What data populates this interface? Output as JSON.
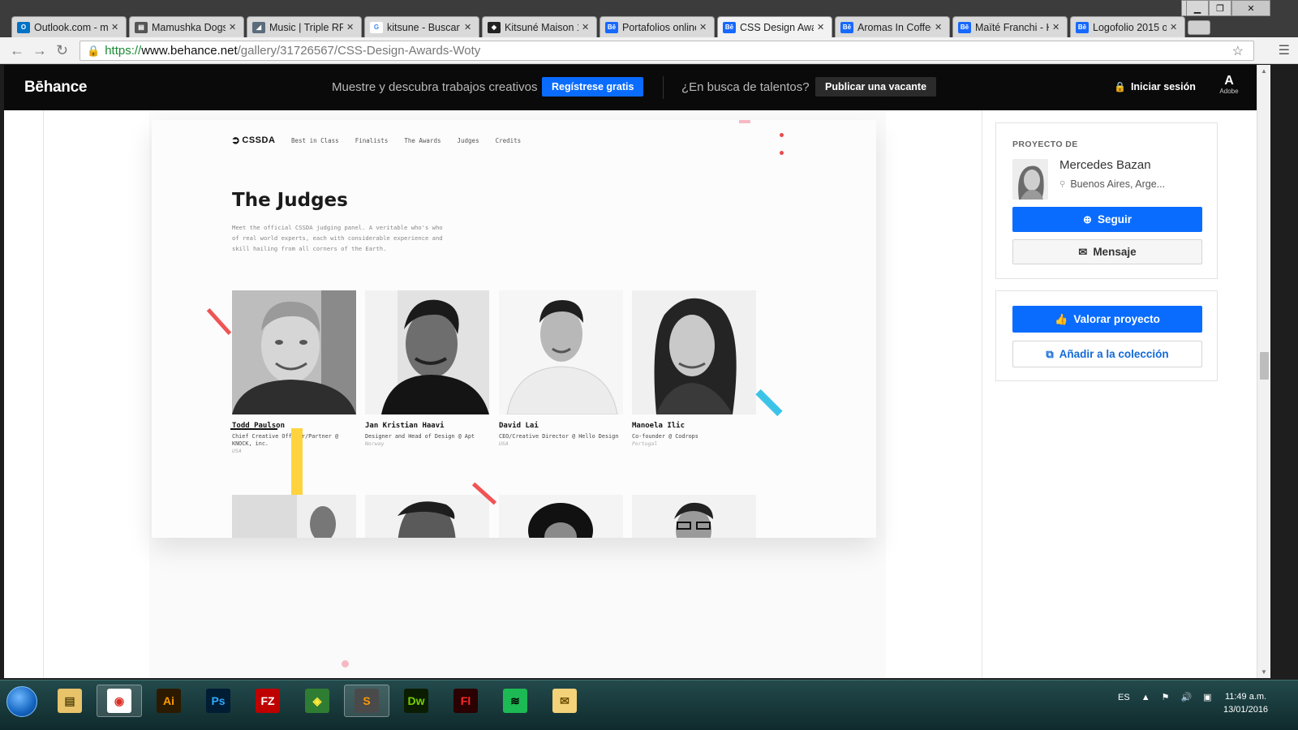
{
  "browser": {
    "tabs": [
      {
        "label": "Outlook.com - m",
        "fav_color": "#0072c6",
        "fav_text": "O"
      },
      {
        "label": "Mamushka Dogs",
        "fav_color": "#555555",
        "fav_text": "▤"
      },
      {
        "label": "Music | Triple RR",
        "fav_color": "#5a6b7c",
        "fav_text": "◢"
      },
      {
        "label": "kitsune - Buscar c",
        "fav_color": "#ffffff",
        "fav_text": "G"
      },
      {
        "label": "Kitsuné Maison 1",
        "fav_color": "#222222",
        "fav_text": "◆"
      },
      {
        "label": "Portafolios online",
        "fav_color": "#1769ff",
        "fav_text": "Bē"
      },
      {
        "label": "CSS Design Awar",
        "fav_color": "#1769ff",
        "fav_text": "Bē",
        "active": true
      },
      {
        "label": "Aromas In Coffee",
        "fav_color": "#1769ff",
        "fav_text": "Bē"
      },
      {
        "label": "Maïté Franchi - H",
        "fav_color": "#1769ff",
        "fav_text": "Bē"
      },
      {
        "label": "Logofolio 2015 o",
        "fav_color": "#1769ff",
        "fav_text": "Bē"
      }
    ],
    "url_scheme": "https://",
    "url_host": "www.behance.net",
    "url_path": "/gallery/31726567/CSS-Design-Awards-Woty"
  },
  "behance": {
    "logo": "Bēhance",
    "tagline": "Muestre y descubra trabajos creativos",
    "register_label": "Regístrese gratis",
    "talent_text": "¿En busca de talentos?",
    "post_job_label": "Publicar una vacante",
    "login_label": "Iniciar sesión",
    "adobe_label": "Adobe"
  },
  "project": {
    "logo": "CSSDA",
    "nav": [
      "Best in Class",
      "Finalists",
      "The Awards",
      "Judges",
      "Credits"
    ],
    "title": "The Judges",
    "intro": "Meet the official CSSDA judging panel. A veritable who's who of real world experts, each with considerable experience and skill hailing from all corners of the Earth.",
    "judges": [
      {
        "name": "Todd Paulson",
        "role": "Chief Creative Officer/Partner @ KNOCK, inc.",
        "country": "USA"
      },
      {
        "name": "Jan Kristian Haavi",
        "role": "Designer and Head of Design @ Apt",
        "country": "Norway"
      },
      {
        "name": "David Lai",
        "role": "CEO/Creative Director @ Hello Design",
        "country": "USA"
      },
      {
        "name": "Manoela Ilic",
        "role": "Co-founder @ Codrops",
        "country": "Portugal"
      }
    ]
  },
  "sidebar": {
    "project_by_label": "PROYECTO DE",
    "owner_name": "Mercedes Bazan",
    "owner_location": "Buenos Aires, Arge...",
    "follow_label": "Seguir",
    "message_label": "Mensaje",
    "appreciate_label": "Valorar proyecto",
    "collection_label": "Añadir a la colección"
  },
  "taskbar": {
    "apps": [
      {
        "name": "explorer",
        "label": "▤",
        "bg": "#e8c36a",
        "color": "#5a4a10"
      },
      {
        "name": "chrome",
        "label": "◉",
        "bg": "#ffffff",
        "color": "#d93025",
        "active": true
      },
      {
        "name": "illustrator",
        "label": "Ai",
        "bg": "#2b1a00",
        "color": "#ff9a00"
      },
      {
        "name": "photoshop",
        "label": "Ps",
        "bg": "#001d34",
        "color": "#31a8ff"
      },
      {
        "name": "filezilla",
        "label": "FZ",
        "bg": "#bf0000",
        "color": "#ffffff"
      },
      {
        "name": "layers",
        "label": "◈",
        "bg": "#2e7d32",
        "color": "#ffeb3b"
      },
      {
        "name": "sublime",
        "label": "S",
        "bg": "#4a4a4a",
        "color": "#ff9800",
        "active": true
      },
      {
        "name": "dreamweaver",
        "label": "Dw",
        "bg": "#0b1d00",
        "color": "#74d100"
      },
      {
        "name": "flash",
        "label": "Fl",
        "bg": "#2a0000",
        "color": "#ff2a2a"
      },
      {
        "name": "spotify",
        "label": "≋",
        "bg": "#1db954",
        "color": "#000000"
      },
      {
        "name": "outlook",
        "label": "✉",
        "bg": "#f3d27a",
        "color": "#6b4e00"
      }
    ],
    "language": "ES",
    "time": "11:49 a.m.",
    "date": "13/01/2016"
  }
}
